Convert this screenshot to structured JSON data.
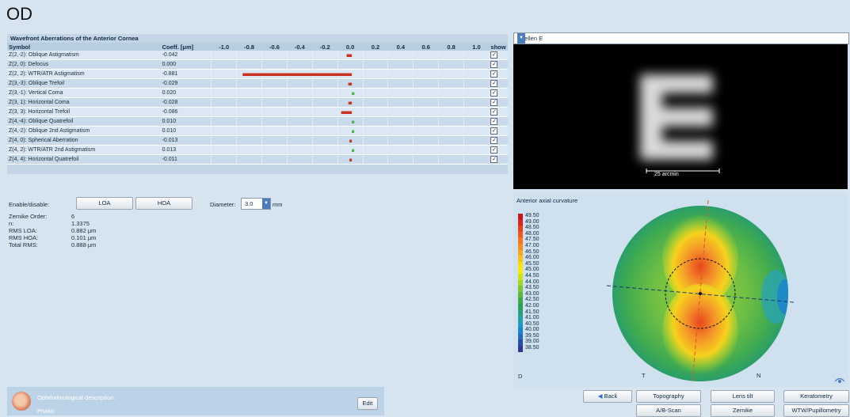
{
  "eye": "OD",
  "wavefront": {
    "title": "Wavefront Aberrations of the Anterior Cornea",
    "headers": {
      "symbol": "Symbol",
      "coeff": "Coeff. [μm]",
      "show": "show"
    },
    "axis_ticks": [
      "-1.0",
      "-0.8",
      "-0.6",
      "-0.4",
      "-0.2",
      "0.0",
      "0.2",
      "0.4",
      "0.6",
      "0.8",
      "1.0"
    ],
    "rows": [
      {
        "symbol": "Z(2,-2): Oblique Astigmatism",
        "coeff": "-0.042",
        "value": -0.042
      },
      {
        "symbol": "Z(2, 0): Defocus",
        "coeff": "0.000",
        "value": 0.0
      },
      {
        "symbol": "Z(2, 2): WTR/ATR Astigmatism",
        "coeff": "-0.881",
        "value": -0.881
      },
      {
        "symbol": "Z(3,-3): Oblique Trefoil",
        "coeff": "-0.029",
        "value": -0.029
      },
      {
        "symbol": "Z(3,-1): Vertical Coma",
        "coeff": "0.020",
        "value": 0.02
      },
      {
        "symbol": "Z(3, 1): Horizontal Coma",
        "coeff": "-0.028",
        "value": -0.028
      },
      {
        "symbol": "Z(3, 3): Horizontal Trefoil",
        "coeff": "-0.086",
        "value": -0.086
      },
      {
        "symbol": "Z(4,-4): Oblique Quatrefoil",
        "coeff": "0.010",
        "value": 0.01
      },
      {
        "symbol": "Z(4,-2): Oblique 2nd Astigmatism",
        "coeff": "0.010",
        "value": 0.01
      },
      {
        "symbol": "Z(4, 0): Spherical Aberration",
        "coeff": "-0.013",
        "value": -0.013
      },
      {
        "symbol": "Z(4, 2): WTR/ATR 2nd Astigmatism",
        "coeff": "0.013",
        "value": 0.013
      },
      {
        "symbol": "Z(4, 4): Horizontal Quatrefoil",
        "coeff": "-0.011",
        "value": -0.011
      }
    ],
    "colors": {
      "negative": "#c8321e",
      "positive": "#4bb34a"
    }
  },
  "controls": {
    "enable_label": "Enable/disable:",
    "loa_button": "LOA",
    "hoa_button": "HOA",
    "diameter_label": "Diameter:",
    "diameter_value": "3.0",
    "diameter_unit": "mm"
  },
  "stats": [
    {
      "label": "Zernike Order:",
      "value": "6"
    },
    {
      "label": "n:",
      "value": "1.3375"
    },
    {
      "label": "RMS LOA:",
      "value": "0.882   μm"
    },
    {
      "label": "RMS HOA:",
      "value": "0.101   μm"
    },
    {
      "label": "Total RMS:",
      "value": "0.888   μm"
    }
  ],
  "snellen": {
    "select_value": "Snellen E",
    "scale_label": "25 arcmin"
  },
  "curvature": {
    "title": "Anterior axial curvature",
    "legend": [
      "49.50",
      "49.00",
      "48.50",
      "48.00",
      "47.50",
      "47.00",
      "46.50",
      "46.00",
      "45.50",
      "45.00",
      "44.50",
      "44.00",
      "43.50",
      "43.00",
      "42.50",
      "42.00",
      "41.50",
      "41.00",
      "40.50",
      "40.00",
      "39.50",
      "39.00",
      "38.50"
    ],
    "legend_colors": [
      "#c4161c",
      "#d9261c",
      "#e2431c",
      "#ea5a1e",
      "#f07620",
      "#f38f20",
      "#f6a81f",
      "#f9c31c",
      "#fbdd16",
      "#f2ea12",
      "#cde21a",
      "#a4d627",
      "#7cc535",
      "#5bb641",
      "#3ea84a",
      "#2e9f5a",
      "#2aa07a",
      "#25a2a0",
      "#2196c5",
      "#1d83c8",
      "#2569b7",
      "#2a4ea4",
      "#2d3a8e"
    ],
    "label_T": "T",
    "label_N": "N",
    "label_D": "D"
  },
  "description": {
    "label": "Ophthalmological description:",
    "value": "Phakic",
    "edit_button": "Edit"
  },
  "nav": {
    "back": "Back",
    "topography": "Topography",
    "lens_tilt": "Lens tilt",
    "keratometry": "Keratometry",
    "ab_scan": "A/B-Scan",
    "zernike": "Zernike",
    "wtw": "WTW/Pupillometry"
  }
}
